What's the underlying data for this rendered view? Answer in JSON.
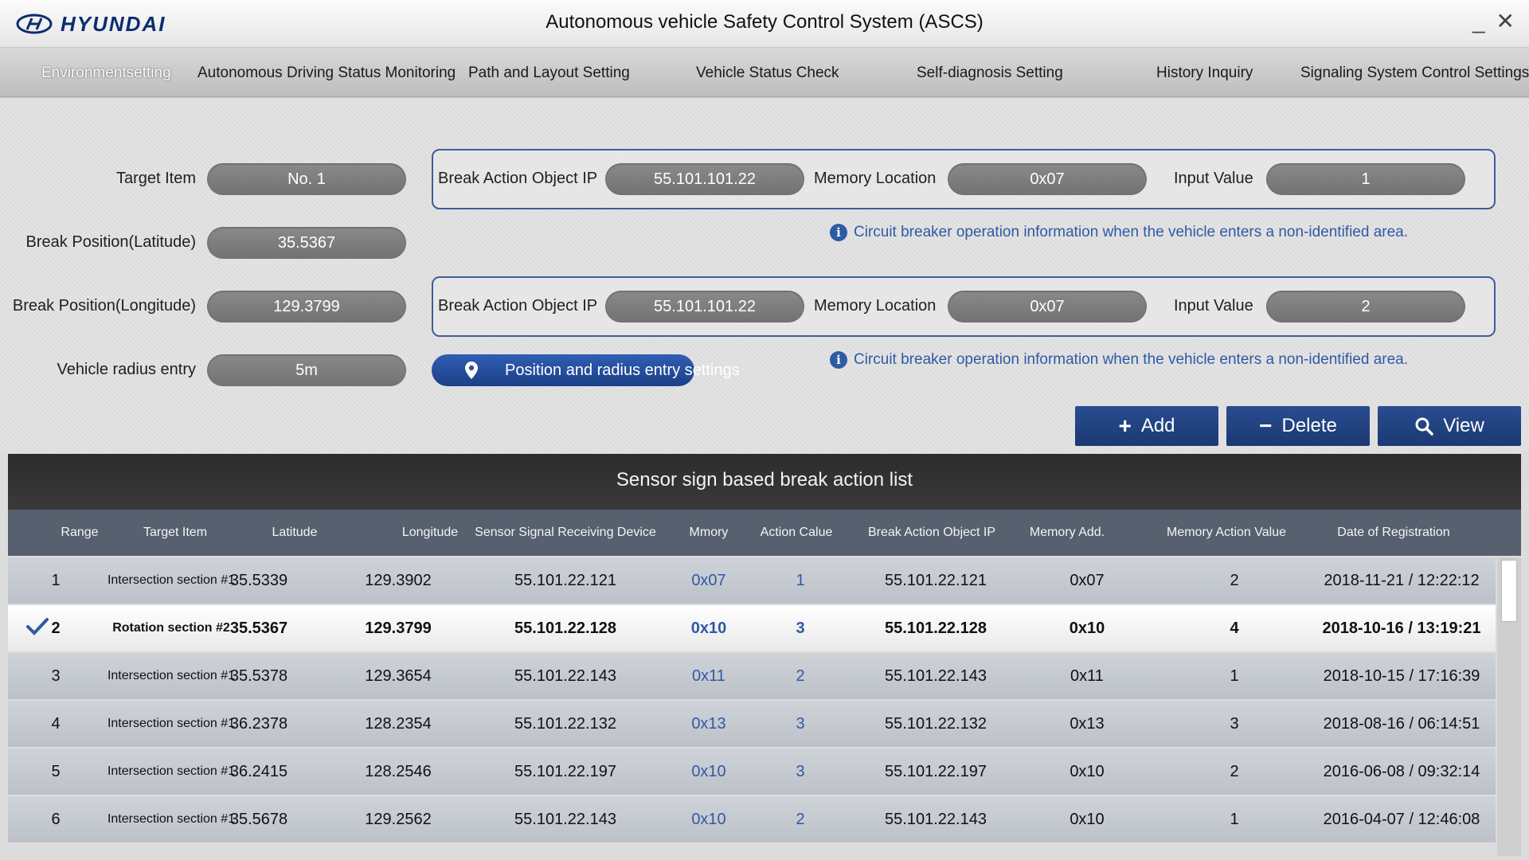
{
  "header": {
    "logo_text": "HYUNDAI",
    "title": "Autonomous vehicle Safety Control System (ASCS)",
    "minimize": "_",
    "close": "✕"
  },
  "menu": {
    "items": [
      {
        "label": "Environmentsetting",
        "active": true
      },
      {
        "label": "Autonomous Driving Status Monitoring"
      },
      {
        "label": "Path and Layout Setting"
      },
      {
        "label": "Vehicle Status Check"
      },
      {
        "label": "Self-diagnosis Setting"
      },
      {
        "label": "History Inquiry"
      },
      {
        "label": "Signaling System Control Settings"
      }
    ]
  },
  "form": {
    "target_item": {
      "label": "Target Item",
      "value": "No. 1"
    },
    "latitude": {
      "label": "Break Position(Latitude)",
      "value": "35.5367"
    },
    "longitude": {
      "label": "Break Position(Longitude)",
      "value": "129.3799"
    },
    "radius": {
      "label": "Vehicle radius entry",
      "value": "5m"
    },
    "group1": {
      "ip_label": "Break Action Object IP",
      "ip_value": "55.101.101.22",
      "mem_label": "Memory Location",
      "mem_value": "0x07",
      "input_label": "Input Value",
      "input_value": "1"
    },
    "group2": {
      "ip_label": "Break Action Object IP",
      "ip_value": "55.101.101.22",
      "mem_label": "Memory Location",
      "mem_value": "0x07",
      "input_label": "Input Value",
      "input_value": "2"
    },
    "info1": "Circuit breaker operation information when the vehicle enters a non-identified area.",
    "info2": "Circuit breaker operation information when the vehicle enters a non-identified area.",
    "position_button": "Position and radius entry settings"
  },
  "actions": {
    "add": "Add",
    "delete": "Delete",
    "view": "View"
  },
  "table": {
    "title": "Sensor sign based break action list",
    "columns": [
      "Range",
      "Target Item",
      "Latitude",
      "Longitude",
      "Sensor Signal Receiving Device",
      "Mmory",
      "Action Calue",
      "Break Action Object IP",
      "Memory Add.",
      "Memory Action Value",
      "Date of Registration"
    ],
    "rows": [
      {
        "range": "1",
        "target": "Intersection section #1",
        "lat": "35.5339",
        "lon": "129.3902",
        "device": "55.101.22.121",
        "memory": "0x07",
        "action": "1",
        "ip": "55.101.22.121",
        "mem_add": "0x07",
        "mem_action": "2",
        "date": "2018-11-21  /  12:22:12",
        "selected": false
      },
      {
        "range": "2",
        "target": "Rotation section #2",
        "lat": "35.5367",
        "lon": "129.3799",
        "device": "55.101.22.128",
        "memory": "0x10",
        "action": "3",
        "ip": "55.101.22.128",
        "mem_add": "0x10",
        "mem_action": "4",
        "date": "2018-10-16  /  13:19:21",
        "selected": true
      },
      {
        "range": "3",
        "target": "Intersection section #1",
        "lat": "35.5378",
        "lon": "129.3654",
        "device": "55.101.22.143",
        "memory": "0x11",
        "action": "2",
        "ip": "55.101.22.143",
        "mem_add": "0x11",
        "mem_action": "1",
        "date": "2018-10-15  /  17:16:39",
        "selected": false
      },
      {
        "range": "4",
        "target": "Intersection section #1",
        "lat": "36.2378",
        "lon": "128.2354",
        "device": "55.101.22.132",
        "memory": "0x13",
        "action": "3",
        "ip": "55.101.22.132",
        "mem_add": "0x13",
        "mem_action": "3",
        "date": "2018-08-16  /  06:14:51",
        "selected": false
      },
      {
        "range": "5",
        "target": "Intersection section #1",
        "lat": "36.2415",
        "lon": "128.2546",
        "device": "55.101.22.197",
        "memory": "0x10",
        "action": "3",
        "ip": "55.101.22.197",
        "mem_add": "0x10",
        "mem_action": "2",
        "date": "2016-06-08  /  09:32:14",
        "selected": false
      },
      {
        "range": "6",
        "target": "Intersection section #1",
        "lat": "35.5678",
        "lon": "129.2562",
        "device": "55.101.22.143",
        "memory": "0x10",
        "action": "2",
        "ip": "55.101.22.143",
        "mem_add": "0x10",
        "mem_action": "1",
        "date": "2016-04-07  /  12:46:08",
        "selected": false
      }
    ]
  },
  "colors": {
    "accent_blue": "#2e5aa6",
    "button_navy": "#1b3873",
    "table_header": "#56606f"
  }
}
